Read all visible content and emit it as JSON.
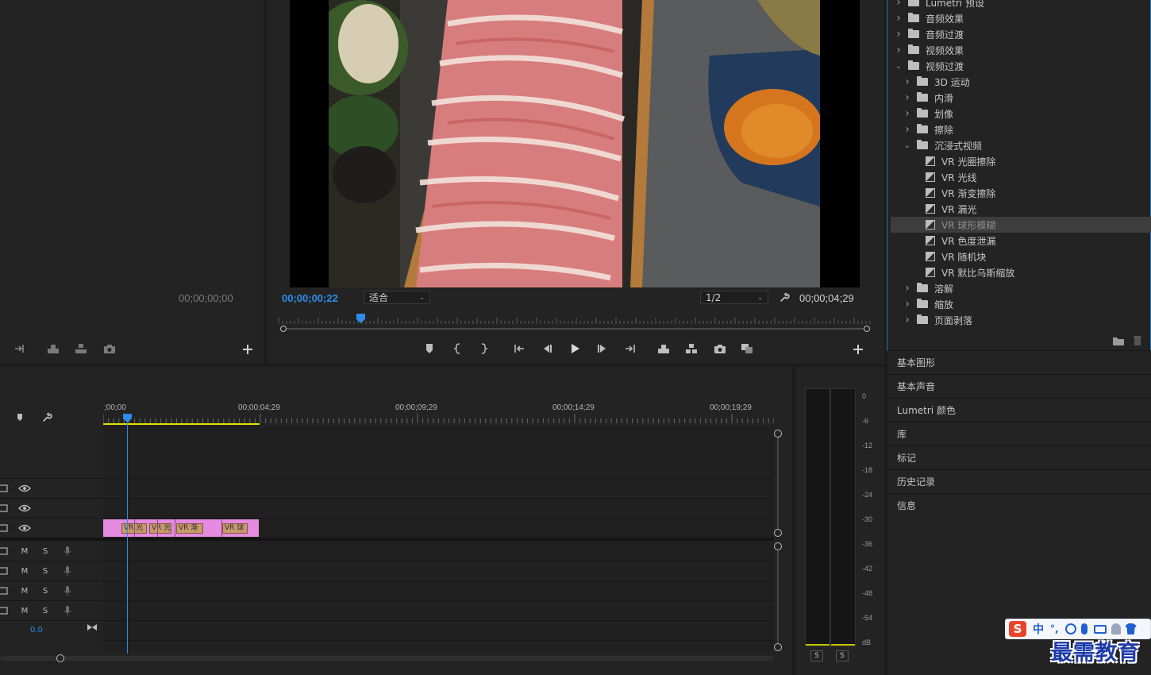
{
  "source_monitor": {
    "timecode": "00;00;00;00"
  },
  "program_monitor": {
    "current_timecode": "00;00;00;22",
    "zoom_select": "适合",
    "resolution_select": "1/2",
    "duration_timecode": "00;00;04;29",
    "playhead_fraction": 0.14
  },
  "effects_tree": {
    "items": [
      {
        "label": "Lumetri 预设",
        "kind": "folder",
        "depth": 0,
        "expanded": false
      },
      {
        "label": "音频效果",
        "kind": "folder",
        "depth": 0,
        "expanded": false
      },
      {
        "label": "音频过渡",
        "kind": "folder",
        "depth": 0,
        "expanded": false
      },
      {
        "label": "视频效果",
        "kind": "folder",
        "depth": 0,
        "expanded": false
      },
      {
        "label": "视频过渡",
        "kind": "folder",
        "depth": 0,
        "expanded": true
      },
      {
        "label": "3D 运动",
        "kind": "folder",
        "depth": 1,
        "expanded": false
      },
      {
        "label": "内滑",
        "kind": "folder",
        "depth": 1,
        "expanded": false
      },
      {
        "label": "划像",
        "kind": "folder",
        "depth": 1,
        "expanded": false
      },
      {
        "label": "擦除",
        "kind": "folder",
        "depth": 1,
        "expanded": false
      },
      {
        "label": "沉浸式视频",
        "kind": "folder",
        "depth": 1,
        "expanded": true
      },
      {
        "label": "VR 光圈擦除",
        "kind": "effect",
        "depth": 2
      },
      {
        "label": "VR 光线",
        "kind": "effect",
        "depth": 2
      },
      {
        "label": "VR 渐变擦除",
        "kind": "effect",
        "depth": 2
      },
      {
        "label": "VR 漏光",
        "kind": "effect",
        "depth": 2
      },
      {
        "label": "VR 球形模糊",
        "kind": "effect",
        "depth": 2,
        "selected": true
      },
      {
        "label": "VR 色度泄漏",
        "kind": "effect",
        "depth": 2
      },
      {
        "label": "VR 随机块",
        "kind": "effect",
        "depth": 2
      },
      {
        "label": "VR 默比乌斯缩放",
        "kind": "effect",
        "depth": 2
      },
      {
        "label": "溶解",
        "kind": "folder",
        "depth": 1,
        "expanded": false
      },
      {
        "label": "缩放",
        "kind": "folder",
        "depth": 1,
        "expanded": false
      },
      {
        "label": "页面剥落",
        "kind": "folder",
        "depth": 1,
        "expanded": false
      }
    ]
  },
  "side_panels": [
    "基本图形",
    "基本声音",
    "Lumetri 颜色",
    "库",
    "标记",
    "历史记录",
    "信息"
  ],
  "timeline": {
    "ruler_labels": [
      ";00;00",
      "00;00;04;29",
      "00;00;09;29",
      "00;00;14;29",
      "00;00;19;29"
    ],
    "audio_tracks": [
      {
        "m": "M",
        "s": "S"
      },
      {
        "m": "M",
        "s": "S"
      },
      {
        "m": "M",
        "s": "S"
      },
      {
        "m": "M",
        "s": "S"
      }
    ],
    "master_volume": "0.0",
    "clips": [
      {
        "label": "VR 光"
      },
      {
        "label": "VR 光"
      },
      {
        "label": "VR 渐"
      },
      {
        "label": "VR 球"
      }
    ],
    "clip_color": "#e58be0",
    "playhead_color": "#2d8ceb",
    "work_area_color": "#e3e000"
  },
  "audio_meter": {
    "scale": [
      "0",
      "-6",
      "-12",
      "-18",
      "-24",
      "-30",
      "-36",
      "-42",
      "-48",
      "-54",
      "dB"
    ],
    "solo_left": "S",
    "solo_right": "S"
  },
  "ime_bar": {
    "logo": "S",
    "mode": "中",
    "punct": "°,"
  },
  "watermark": "最需教育"
}
